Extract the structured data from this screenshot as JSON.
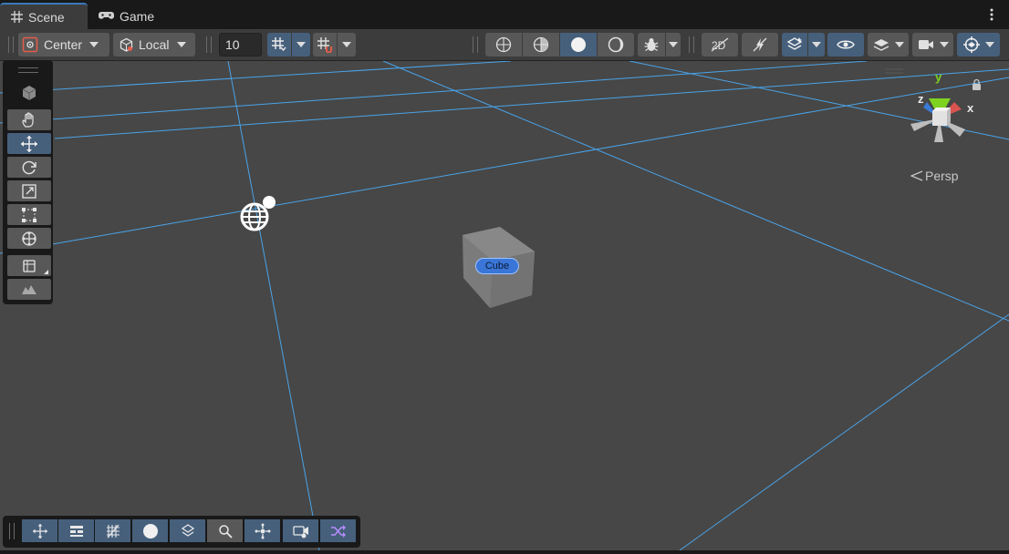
{
  "tabs": [
    {
      "label": "Scene",
      "icon": "grid-icon",
      "active": true
    },
    {
      "label": "Game",
      "icon": "gamepad-icon",
      "active": false
    }
  ],
  "toolbar": {
    "pivot_mode": "Center",
    "pivot_rotation": "Local",
    "grid_size": "10",
    "icons": [
      "grid-snap-icon",
      "snap-increment-icon",
      "wireframe-shading-icon",
      "shaded-wireframe-icon",
      "shaded-icon",
      "unlit-icon",
      "debug-bug-icon",
      "2d-toggle-icon",
      "lighting-toggle-icon",
      "effects-icon",
      "visibility-eye-icon",
      "layers-icon",
      "camera-icon",
      "gizmos-icon"
    ]
  },
  "tools": [
    "view-cube-icon",
    "hand-tool-icon",
    "move-tool-icon",
    "rotate-tool-icon",
    "scale-tool-icon",
    "rect-tool-icon",
    "transform-tool-icon",
    "custom-editor-tool-icon",
    "terrain-tool-icon"
  ],
  "bottom_toolbar": [
    "move-icon",
    "inspector-icon",
    "grid-snap-icon",
    "circle-icon",
    "layers-icon",
    "search-icon",
    "pivot-icon",
    "camera-preview-icon",
    "shuffle-icon"
  ],
  "scene": {
    "cube_label": "Cube",
    "projection": "Persp",
    "gizmo_axes": {
      "x": "x",
      "y": "y",
      "z": "z"
    }
  },
  "colors": {
    "accent": "#46607c",
    "grid_line": "#4aa3e8",
    "viewport_bg": "#474747",
    "x_axis": "#d9534f",
    "y_axis": "#7ed321",
    "z_axis": "#3a7bd5"
  }
}
